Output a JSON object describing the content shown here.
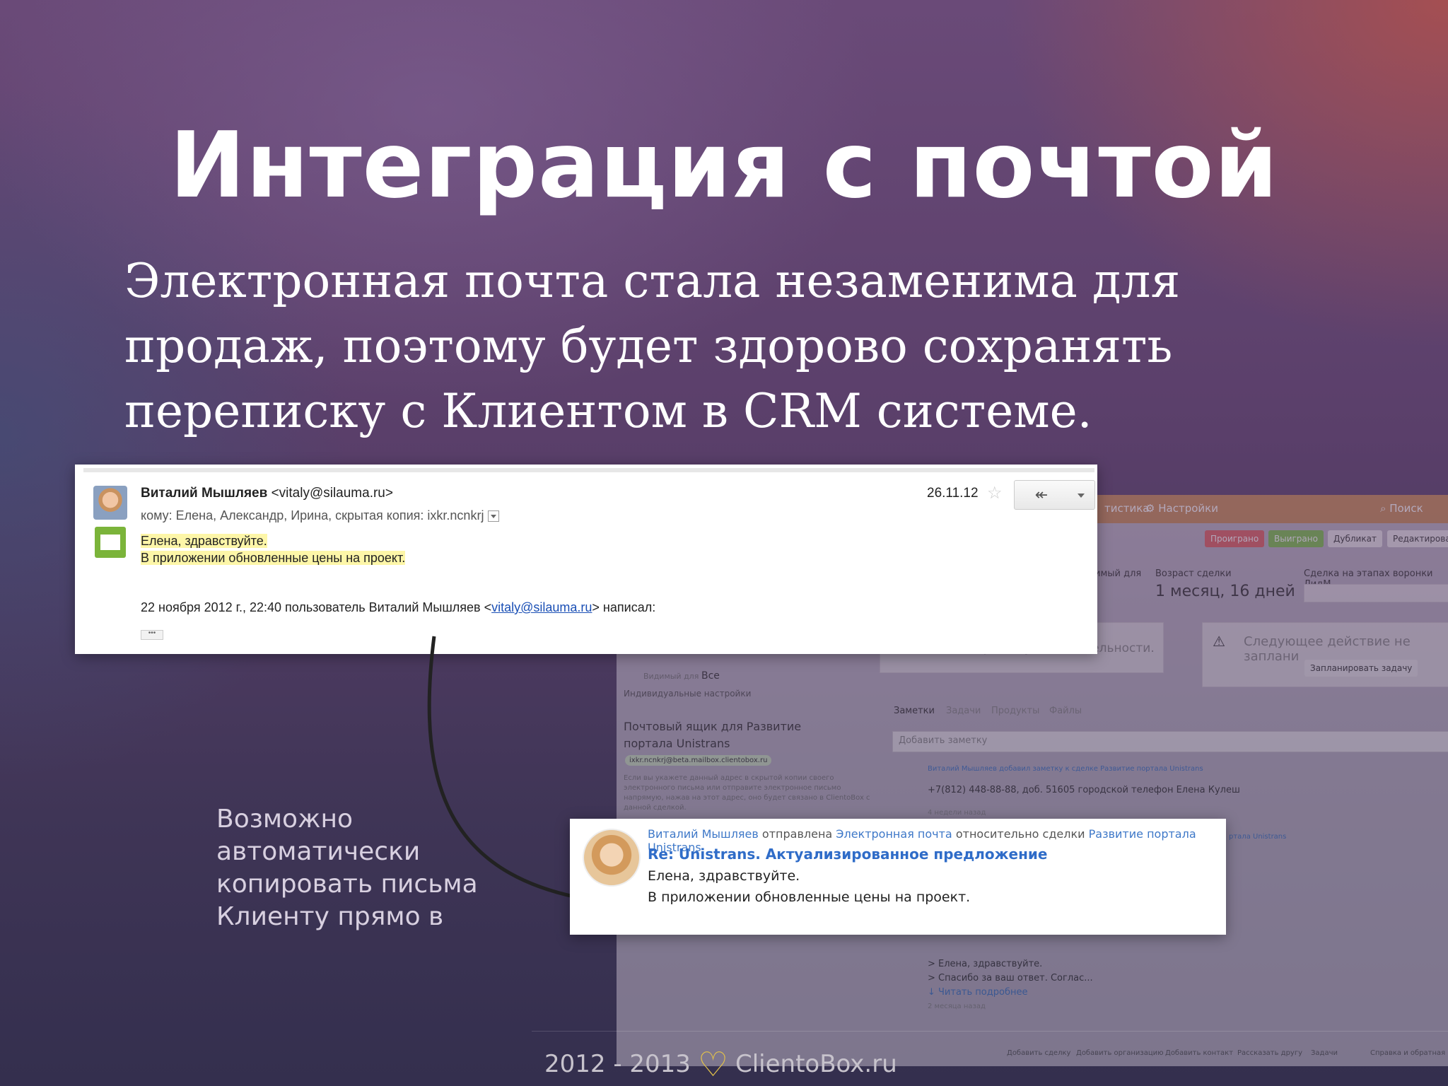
{
  "slide": {
    "title": "Интеграция с почтой",
    "subtitle": "Электронная почта стала незаменима для продаж, поэтому будет здорово сохранять переписку с Клиентом в CRM системе.",
    "side_text": "Возможно автоматически копировать письма Клиенту прямо в"
  },
  "email": {
    "sender_name": "Виталий Мышляев",
    "sender_email": "<vitaly@silauma.ru>",
    "to_line": "кому: Елена, Александр, Ирина, скрытая копия: ixkr.ncnkrj",
    "greeting": "Елена, здравствуйте.",
    "body": "В приложении обновленные цены на проект.",
    "quote_prefix": "22 ноября 2012 г., 22:40 пользователь Виталий Мышляев <",
    "quote_link": "vitaly@silauma.ru",
    "quote_suffix": "> написал:",
    "dots": "•••",
    "date": "26.11.12",
    "star_icon": "star-icon",
    "reply_icon": "reply-all-icon"
  },
  "crm": {
    "nav_stats": "тистика",
    "nav_settings": "Настройки",
    "search": "Поиск",
    "btn_lost": "Проиграно",
    "btn_won": "Выиграно",
    "btn_duplicate": "Дубликат",
    "btn_edit": "Редактировать",
    "visible_for_label": "имый для",
    "deal_age_label": "Возраст сделки",
    "deal_age_value": "1 месяц, 16 дней",
    "funnel_label": "Сделка на этапах воронки ЛидМ",
    "no_prev": "Нет предыдущей деятельности.",
    "next_action": "Следующее действие не заплани",
    "plan_task": "Запланировать задачу",
    "visible_all_label": "Видимый для",
    "visible_all_value": "Все",
    "individual_settings": "Индивидуальные настройки",
    "mailbox_title": "Почтовый ящик для Развитие портала Unistrans",
    "mailbox_address": "ixkr.ncnkrj@beta.mailbox.clientobox.ru",
    "mailbox_hint": "Если вы укажете данный адрес в скрытой копии своего электронного письма или отправите электронное письмо напрямую, нажав на этот адрес, оно будет связано в ClientoBox с данной сделкой.",
    "tab_notes": "Заметки",
    "tab_tasks": "Задачи",
    "tab_products": "Продукты",
    "tab_files": "Файлы",
    "add_note": "Добавить заметку",
    "note_meta": "Виталий Мышляев добавил заметку к сделке Развитие портала Unistrans",
    "note_phone": "+7(812) 448-88-88, доб. 51605 городской телефон Елена Кулеш",
    "note_time": "4 недели назад",
    "side_link": "ртала Unistrans",
    "quote1": "> Елена, здравствуйте.",
    "quote2": "> Спасибо за ваш ответ. Соглас...",
    "read_more": "↓ Читать подробнее",
    "quote_time": "2 месяца назад",
    "footer_links": [
      "Добавить сделку",
      "Добавить организацию",
      "Добавить контакт",
      "Рассказать другу",
      "Задачи",
      "Справка и обратная"
    ]
  },
  "note": {
    "author": "Виталий Мышляев",
    "sent": "отправлена",
    "channel": "Электронная почта",
    "relation": "относительно сделки",
    "deal": "Развитие портала Unistrans",
    "subject": "Re: Unistrans. Актуализированное предложение",
    "greeting": "Елена, здравствуйте.",
    "body": "В приложении обновленные цены на проект."
  },
  "footer": {
    "years": "2012 - 2013",
    "heart_icon": "heart-icon",
    "site": "ClientoBox.ru"
  }
}
